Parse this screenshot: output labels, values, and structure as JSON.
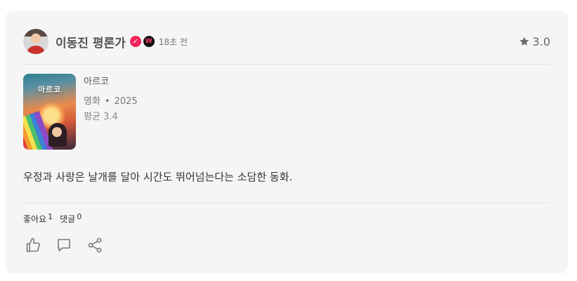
{
  "user": {
    "name": "이동진 평론가",
    "time": "18초 전",
    "badge_w": "W"
  },
  "rating": {
    "value": "3.0"
  },
  "movie": {
    "poster_title": "아르코",
    "title": "아르코",
    "category": "영화",
    "separator": "•",
    "year": "2025",
    "average": "평균 3.4"
  },
  "review": {
    "text": "우정과 사랑은 날개를 달아 시간도 뛰어넘는다는 소담한 동화."
  },
  "counts": {
    "likes_label": "좋아요",
    "likes_value": "1",
    "comments_label": "댓글",
    "comments_value": "0"
  },
  "icons": {
    "verified": "check-badge-icon",
    "star": "star-icon",
    "like": "thumbs-up-icon",
    "comment": "comment-icon",
    "share": "share-icon"
  },
  "colors": {
    "card_bg": "#f5f5f5",
    "verified_badge": "#f0245a",
    "text_muted": "#777777"
  }
}
